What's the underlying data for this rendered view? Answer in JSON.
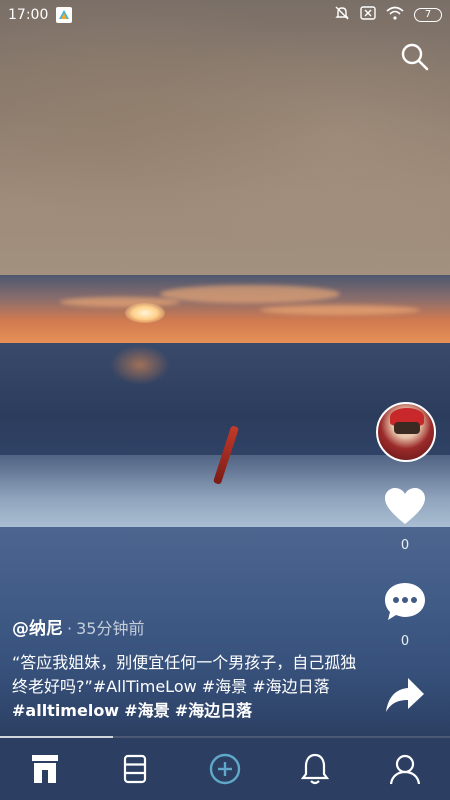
{
  "status_bar": {
    "time": "17:00",
    "battery_level": "7",
    "icons": [
      "app-badge-icon",
      "mute-icon",
      "no-sim-icon",
      "wifi-icon",
      "battery-icon"
    ]
  },
  "colors": {
    "accent_plus": "#5fa8c8",
    "nav_background": "#2c3f63"
  },
  "post": {
    "username": "@纳尼",
    "separator": "·",
    "time_ago": "35分钟前",
    "description_text": "“答应我姐妹，别便宜任何一个男孩子，自己孤独终老好吗?”#AllTimeLow #海景 #海边日落",
    "hashtags": [
      "#alltimelow",
      "#海景",
      "#海边日落"
    ]
  },
  "actions": {
    "like_count": "0",
    "comment_count": "0"
  },
  "playback": {
    "progress": 0.25
  },
  "bottom_nav": {
    "items": [
      "home-icon",
      "list-icon",
      "add-icon",
      "notification-bell-icon",
      "profile-icon"
    ]
  }
}
